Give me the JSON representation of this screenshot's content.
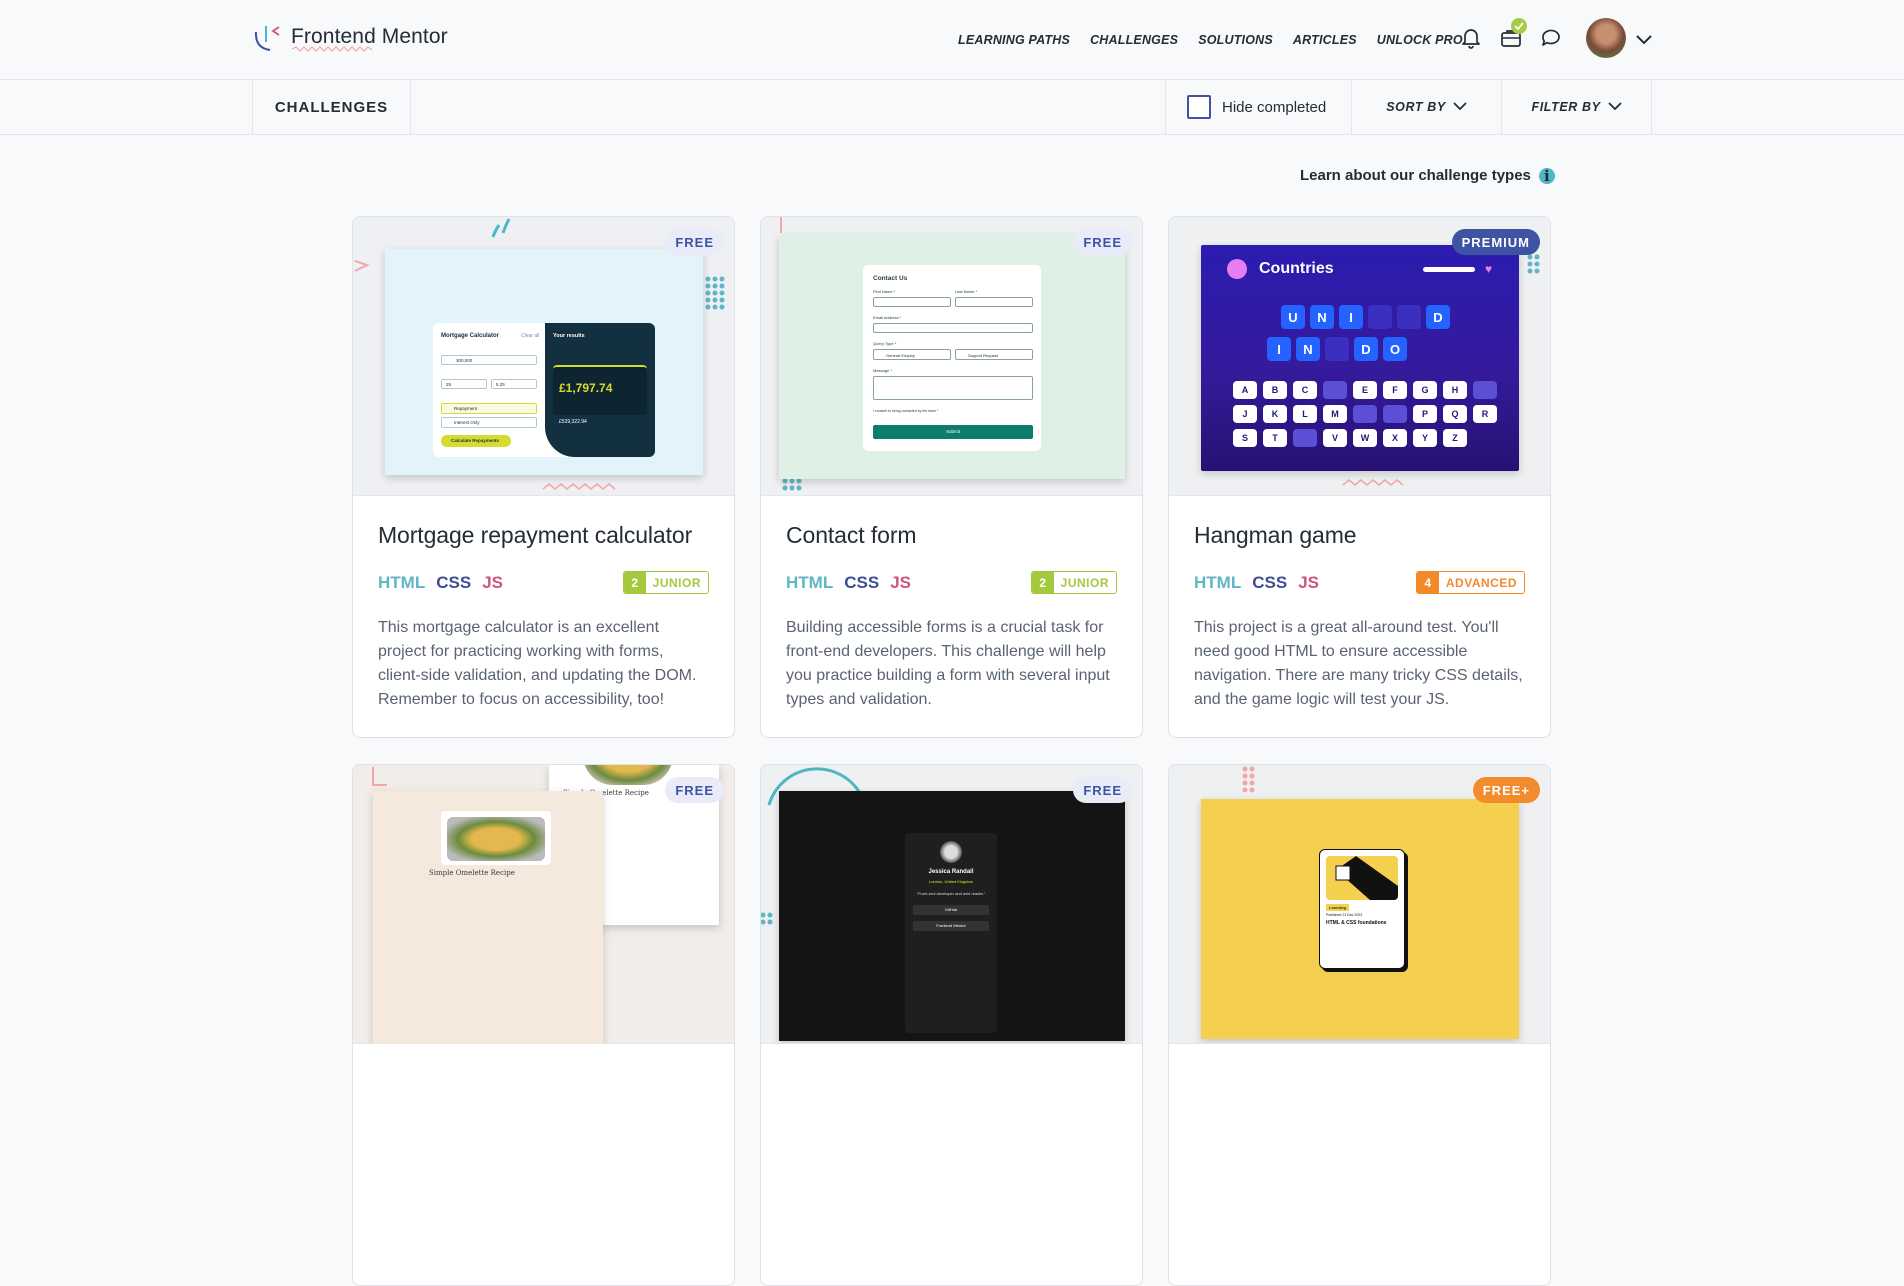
{
  "brand": {
    "name": "Frontend Mentor"
  },
  "nav": {
    "items": [
      "LEARNING PATHS",
      "CHALLENGES",
      "SOLUTIONS",
      "ARTICLES",
      "UNLOCK PRO"
    ]
  },
  "nav_icons": [
    "bell-icon",
    "briefcase-icon",
    "chat-icon"
  ],
  "subbar": {
    "title": "CHALLENGES",
    "hide_completed": "Hide completed",
    "sort_by": "SORT BY",
    "filter_by": "FILTER BY"
  },
  "learn_link": "Learn about our challenge types",
  "colors": {
    "html": "#5fb6c4",
    "css": "#3d4f92",
    "js": "#d1537f",
    "junior": "#a5c93d",
    "advanced": "#f38a2a",
    "brand_blue": "#3e54a3"
  },
  "cards": [
    {
      "title": "Mortgage repayment calculator",
      "tier": "FREE",
      "langs": [
        "HTML",
        "CSS",
        "JS"
      ],
      "level_num": "2",
      "level": "JUNIOR",
      "desc": "This mortgage calculator is an excellent project for practicing working with forms, client-side validation, and updating the DOM. Remember to focus on accessibility, too!",
      "preview": {
        "heading": "Mortgage Calculator",
        "clear": "Clear all",
        "results": "Your results",
        "amount": "£1,797.74",
        "total": "£539,322.94",
        "button": "Calculate Repayments",
        "opt1": "Repayment",
        "opt2": "Interest Only",
        "field": "300,000",
        "years": "25",
        "rate": "5.25"
      }
    },
    {
      "title": "Contact form",
      "tier": "FREE",
      "langs": [
        "HTML",
        "CSS",
        "JS"
      ],
      "level_num": "2",
      "level": "JUNIOR",
      "desc": "Building accessible forms is a crucial task for front-end developers. This challenge will help you practice building a form with several input types and validation.",
      "preview": {
        "heading": "Contact Us",
        "first": "First Name *",
        "last": "Last Name *",
        "email": "Email Address *",
        "query": "Query Type *",
        "q1": "General Enquiry",
        "q2": "Support Request",
        "message": "Message *",
        "consent": "I consent to being contacted by the team *",
        "submit": "Submit"
      }
    },
    {
      "title": "Hangman game",
      "tier": "PREMIUM",
      "langs": [
        "HTML",
        "CSS",
        "JS"
      ],
      "level_num": "4",
      "level": "ADVANCED",
      "desc": "This project is a great all-around test. You'll need good HTML to ensure accessible navigation. There are many tricky CSS details, and the game logic will test your JS.",
      "preview": {
        "heading": "Countries",
        "row1": [
          "U",
          "N",
          "I",
          "",
          "",
          "D"
        ],
        "row2": [
          "I",
          "N",
          "",
          "D",
          "O"
        ],
        "keys1": [
          "A",
          "B",
          "C",
          "D",
          "E",
          "F",
          "G",
          "H",
          "I"
        ],
        "keys2": [
          "J",
          "K",
          "L",
          "M",
          "N",
          "O",
          "P",
          "Q",
          "R"
        ],
        "keys3": [
          "S",
          "T",
          "U",
          "V",
          "W",
          "X",
          "Y",
          "Z"
        ]
      }
    },
    {
      "tier": "FREE",
      "preview": {
        "heading": "Simple Omelette Recipe",
        "heading2": "Simple Omelette Recipe"
      }
    },
    {
      "tier": "FREE",
      "preview": {
        "name": "Jessica Randall",
        "location": "London, United Kingdom",
        "bio": "\"Front-end developer and avid reader.\"",
        "link1": "GitHub",
        "link2": "Frontend Mentor"
      }
    },
    {
      "tier": "FREE+",
      "preview": {
        "tag": "Learning",
        "date": "Published 21 Dec 2023",
        "title": "HTML & CSS foundations"
      }
    }
  ]
}
